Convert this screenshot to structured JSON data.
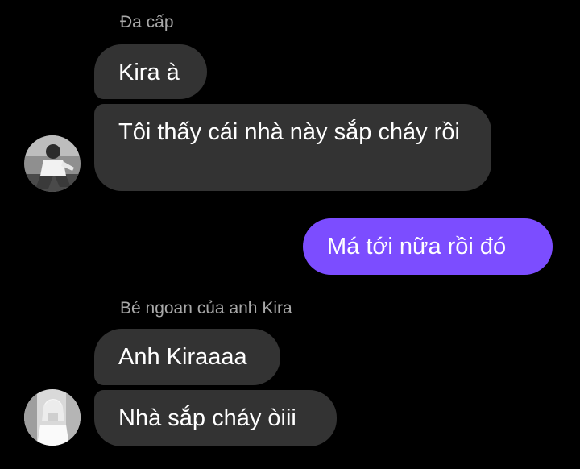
{
  "thread": {
    "group1": {
      "sender_name": "Đa cấp",
      "messages": [
        "Kira à",
        "Tôi thấy cái nhà này sắp cháy rồi"
      ]
    },
    "outgoing": {
      "message": "Má tới nữa rồi đó"
    },
    "group2": {
      "sender_name": "Bé ngoan của anh Kira",
      "messages": [
        "Anh Kiraaaa",
        "Nhà sắp cháy òiii"
      ]
    }
  },
  "colors": {
    "background": "#000000",
    "incoming_bubble": "#333333",
    "outgoing_bubble": "#7c4dff",
    "sender_name": "#a8a8a8",
    "text": "#ffffff"
  },
  "icons": [
    "avatar-photo-1",
    "avatar-photo-2"
  ]
}
